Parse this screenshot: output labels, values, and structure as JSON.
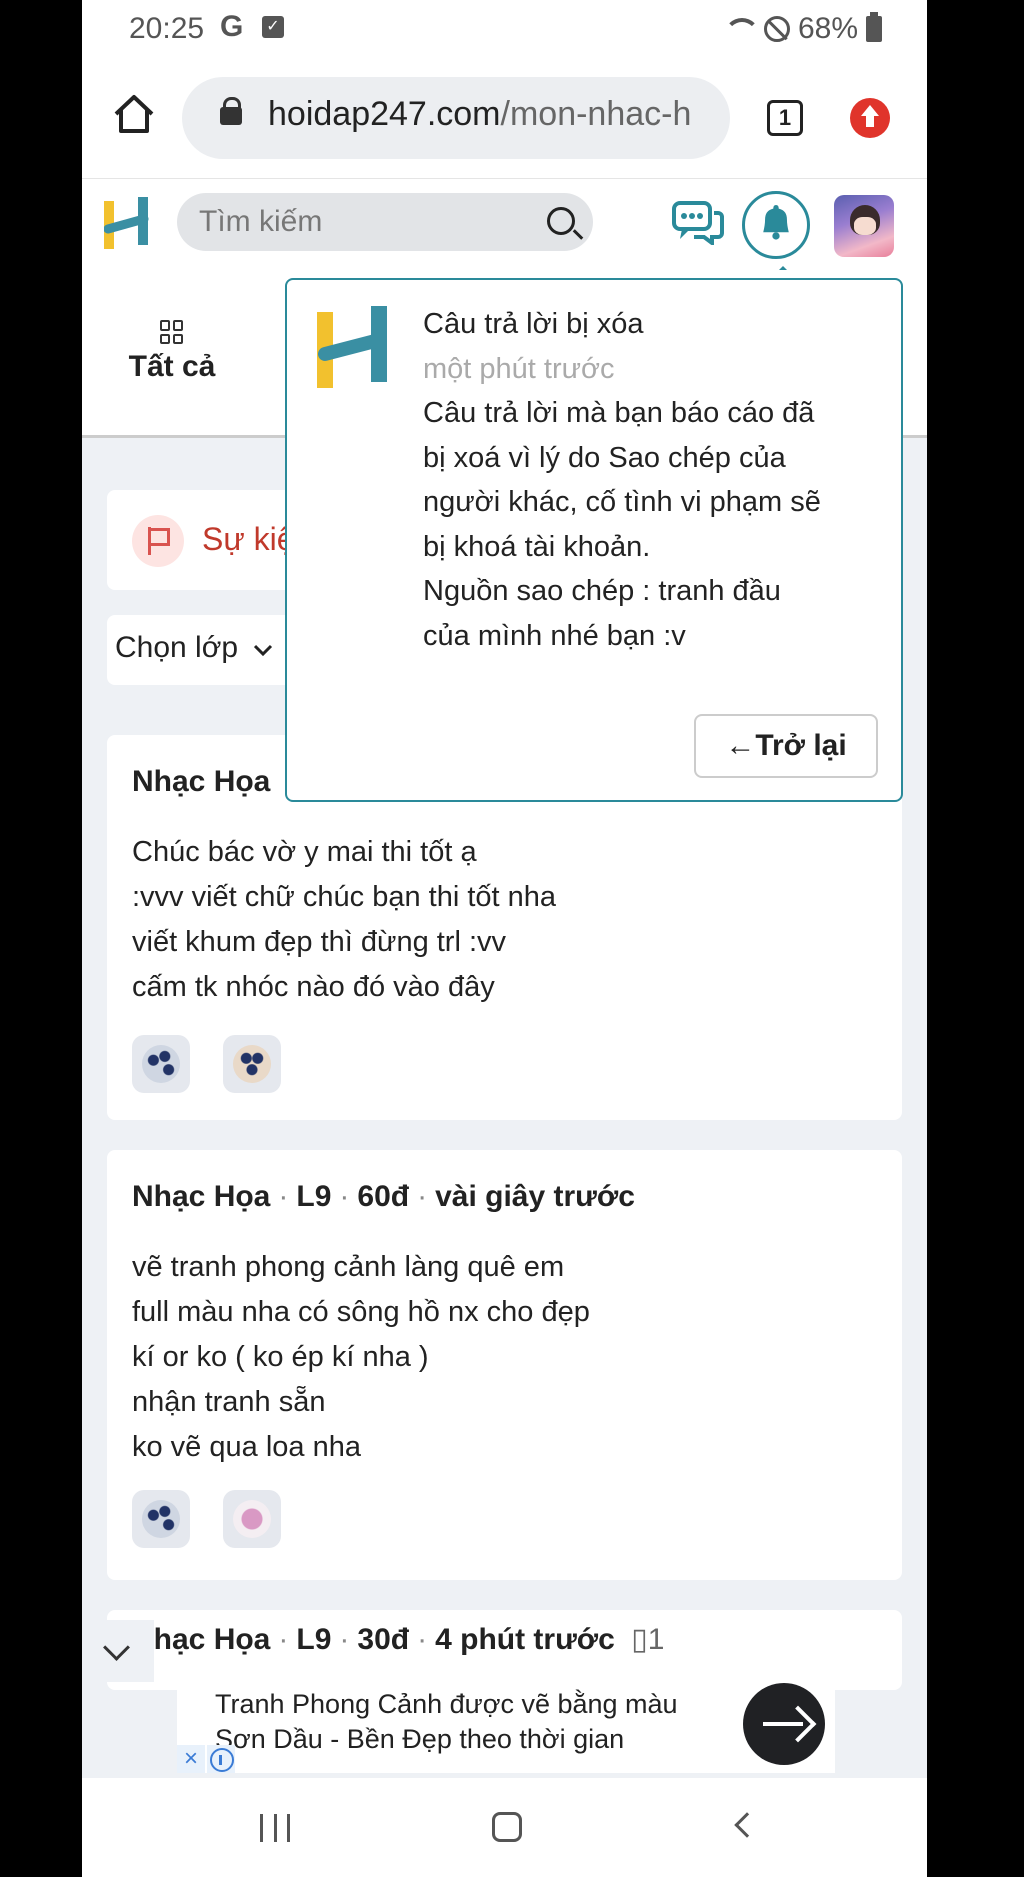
{
  "status_bar": {
    "time": "20:25",
    "g_label": "G",
    "battery": "68%"
  },
  "browser": {
    "url_main": "hoidap247.com",
    "url_path": "/mon-nhac-h",
    "tab_count": "1"
  },
  "header": {
    "search_placeholder": "Tìm kiếm"
  },
  "categories": {
    "all_label": "Tất cả"
  },
  "event": {
    "label": "Sự kiện"
  },
  "class_select": {
    "label": "Chọn lớp"
  },
  "posts": [
    {
      "author": "Nhạc Họa",
      "lines": [
        "Chúc bác vờ y mai thi tốt ạ",
        ":vvv viết chữ chúc bạn thi tốt nha",
        "viết khum đẹp thì đừng trl :vv",
        "cấm tk nhóc nào đó vào đây"
      ]
    },
    {
      "author": "Nhạc Họa",
      "level": "L9",
      "points": "60đ",
      "time": "vài giây trước",
      "lines": [
        "vẽ tranh phong cảnh làng quê em",
        "full màu nha có sông hồ nx cho đẹp",
        "kí or ko ( ko ép kí nha )",
        "nhận tranh sẵn",
        "ko vẽ qua loa nha"
      ]
    },
    {
      "author": "Nhạc Họa",
      "level": "L9",
      "points": "30đ",
      "time": "4 phút trước",
      "attachments": "1"
    }
  ],
  "ad": {
    "line1": "Tranh Phong Cảnh được vẽ bằng màu",
    "line2": "Sơn Dầu - Bền Đẹp theo thời gian"
  },
  "notification": {
    "title": "Câu trả lời bị xóa",
    "time": "một phút trước",
    "message_lines": [
      "Câu trả lời mà bạn báo cáo đã",
      "bị xoá vì lý do Sao chép của",
      "người khác, cố tình vi phạm sẽ",
      "bị khoá tài khoản.",
      "Nguồn sao chép : tranh đầu",
      "của mình nhé bạn :v"
    ],
    "back_label": "←Trở lại"
  },
  "colors": {
    "accent": "#2a8a9a",
    "logo_yellow": "#f2c12e",
    "logo_teal": "#3a8fa3"
  }
}
